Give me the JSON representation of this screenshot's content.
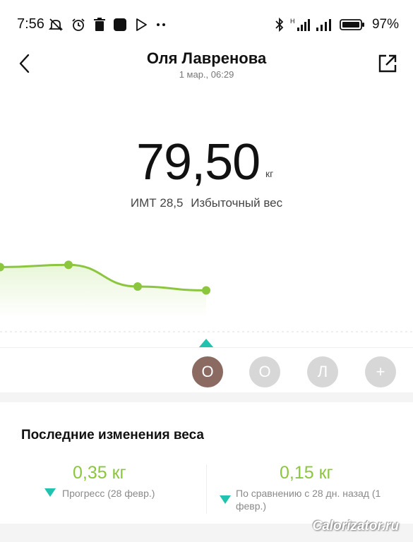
{
  "status_bar": {
    "time": "7:56",
    "battery_percent": "97",
    "battery_suffix": "%"
  },
  "header": {
    "title": "Оля Лавренова",
    "subtitle": "1 мар., 06:29"
  },
  "measurement": {
    "weight": "79,50",
    "unit": "кг",
    "bmi_label": "ИМТ 28,5",
    "bmi_status": "Избыточный вес"
  },
  "chart_data": {
    "type": "area",
    "points": [
      {
        "y": 79.95
      },
      {
        "y": 79.98
      },
      {
        "y": 79.7
      },
      {
        "y": 79.65
      }
    ],
    "line_color": "#8cc63f",
    "fill_color": "#e9f6d9"
  },
  "users": [
    {
      "initial": "О",
      "active": true
    },
    {
      "initial": "О",
      "active": false
    },
    {
      "initial": "Л",
      "active": false
    },
    {
      "initial": "+",
      "active": false
    }
  ],
  "recent_changes": {
    "title": "Последние изменения веса",
    "items": [
      {
        "value": "0,35 кг",
        "desc": "Прогресс (28 февр.)"
      },
      {
        "value": "0,15 кг",
        "desc_line1": "По сравнению с 28 дн. назад (1",
        "desc_line2": "февр.)"
      }
    ]
  },
  "watermark": "Calorizator.ru",
  "colors": {
    "accent_green": "#8cc63f",
    "pointer_teal": "#21c2ae",
    "active_avatar": "#8b6a62"
  }
}
